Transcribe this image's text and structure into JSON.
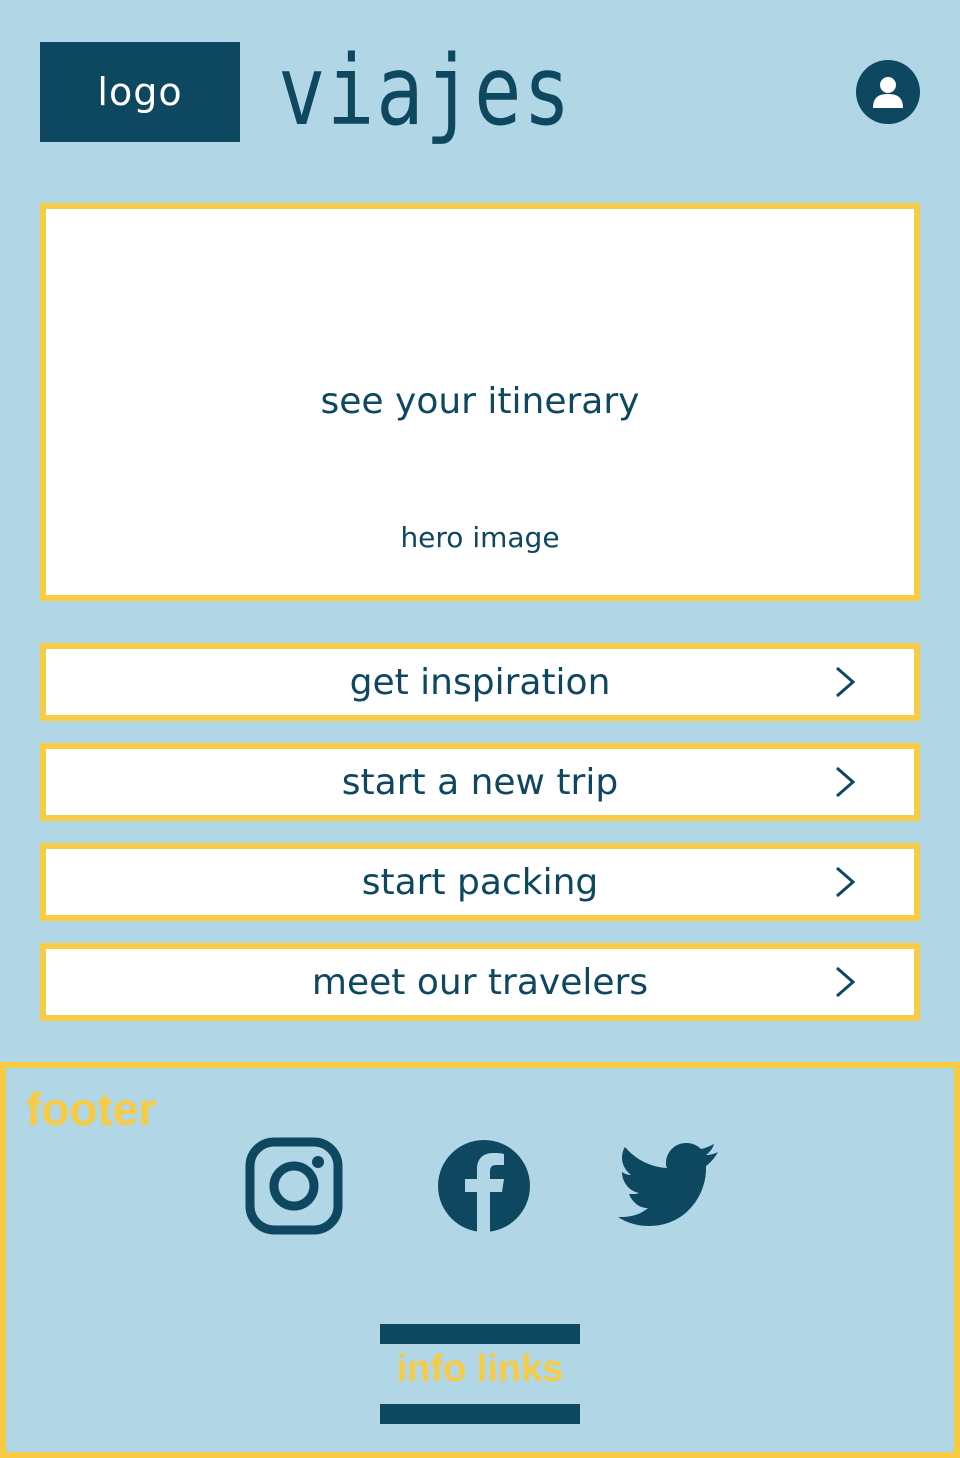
{
  "header": {
    "logo_label": "logo",
    "brand_title": "viajes",
    "user_icon": "user-icon"
  },
  "hero": {
    "cta_label": "see your itinerary",
    "image_label": "hero image"
  },
  "menu": {
    "items": [
      {
        "label": "get inspiration",
        "icon": "chevron-right-icon"
      },
      {
        "label": "start a new trip",
        "icon": "chevron-right-icon"
      },
      {
        "label": "start packing",
        "icon": "chevron-right-icon"
      },
      {
        "label": "meet our travelers",
        "icon": "chevron-right-icon"
      }
    ]
  },
  "footer": {
    "label": "footer",
    "social_icons": [
      "instagram-icon",
      "facebook-icon",
      "twitter-icon"
    ],
    "info_links_label": "info links"
  },
  "colors": {
    "background": "#b1d7e6",
    "primary": "#0e4760",
    "accent": "#f7cb44",
    "surface": "#ffffff"
  }
}
